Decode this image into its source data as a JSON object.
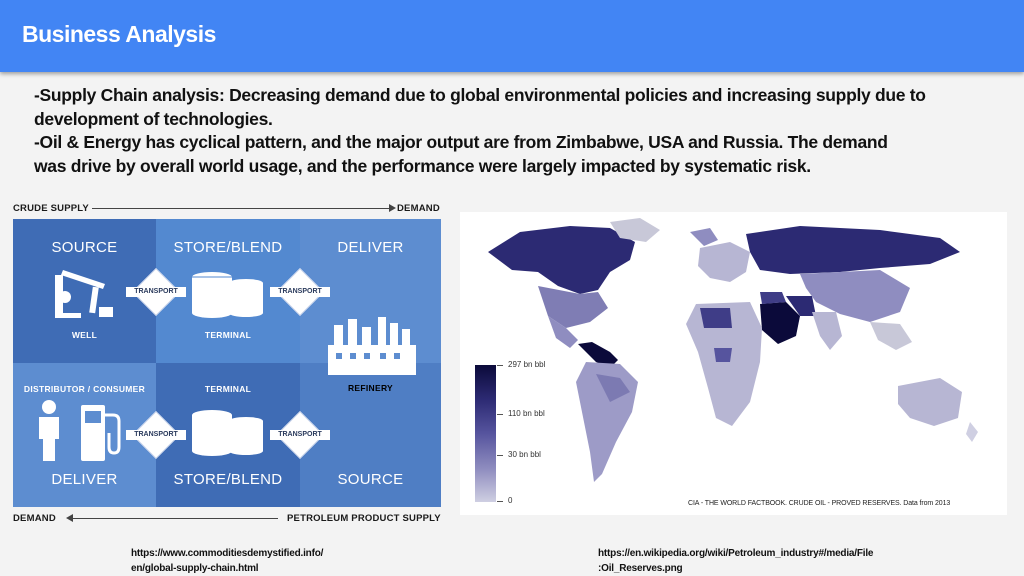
{
  "header": {
    "title": "Business Analysis"
  },
  "body": {
    "line1": "-Supply Chain analysis: Decreasing demand due to global environmental policies and increasing supply due to",
    "line2": "development of technologies.",
    "line3": "-Oil & Energy has cyclical pattern, and the major output are from Zimbabwe, USA and Russia. The demand",
    "line4": "was drive by overall world usage, and the performance were largely impacted by systematic risk."
  },
  "diagram": {
    "top_left_label": "CRUDE SUPPLY",
    "top_right_label": "DEMAND",
    "bottom_left_label": "DEMAND",
    "bottom_right_label": "PETROLEUM PRODUCT SUPPLY",
    "cells": {
      "source_top": {
        "title": "SOURCE",
        "sub": "WELL"
      },
      "store_top": {
        "title": "STORE/BLEND",
        "sub": "TERMINAL"
      },
      "deliver_top": {
        "title": "DELIVER"
      },
      "refinery": {
        "sub": "REFINERY"
      },
      "distributor": {
        "sub": "DISTRIBUTOR / CONSUMER",
        "title": "DELIVER"
      },
      "store_bottom": {
        "sub": "TERMINAL",
        "title": "STORE/BLEND"
      },
      "source_bottom": {
        "title": "SOURCE"
      }
    },
    "transport_label": "TRANSPORT",
    "colors": {
      "dark": "#3f6cb5",
      "mid": "#4f7ec4",
      "light": "#5d8dd0"
    }
  },
  "map": {
    "legend": {
      "max": "297 bn bbl",
      "mid": "110 bn bbl",
      "low": "30 bn bbl",
      "zero": "0"
    },
    "credit": "CIA - THE WORLD FACTBOOK. CRUDE OIL - PROVED RESERVES. Data from 2013"
  },
  "sources": {
    "left_line1": "https://www.commoditiesdemystified.info/",
    "left_line2": "en/global-supply-chain.html",
    "right_line1": "https://en.wikipedia.org/wiki/Petroleum_industry#/media/File",
    "right_line2": ":Oil_Reserves.png"
  }
}
